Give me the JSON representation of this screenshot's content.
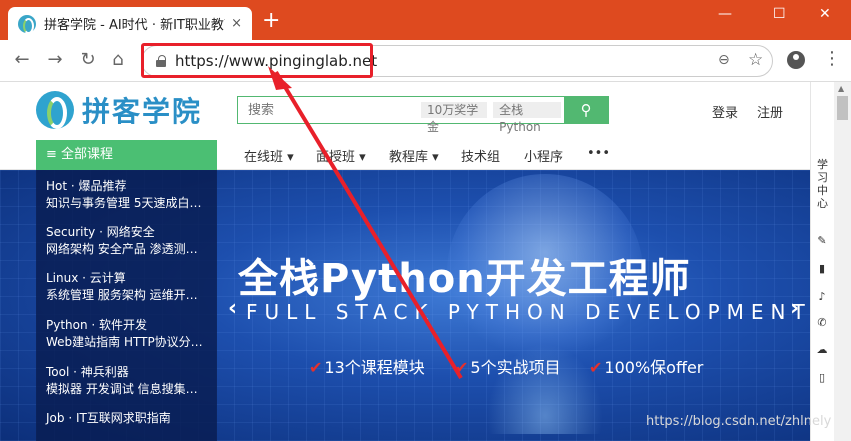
{
  "browser": {
    "tab_title": "拼客学院 - AI时代 · 新IT职业教育",
    "tab_close": "×",
    "new_tab": "+",
    "url": "https://www.pinginglab.net",
    "controls": {
      "minimize": "—",
      "maximize": "☐",
      "close": "✕"
    },
    "nav": {
      "back": "←",
      "forward": "→",
      "reload": "↻",
      "home": "⌂"
    },
    "icons": {
      "zoom": "⊖",
      "star": "☆",
      "menu": "⋮"
    }
  },
  "site": {
    "logo_text": "拼客学院",
    "search_placeholder": "搜索",
    "search_tags": [
      "10万奖学金",
      "全栈Python"
    ],
    "search_button": "⚲",
    "login": "登录",
    "register": "注册",
    "all_courses": "≡  全部课程",
    "nav_items": [
      "在线班 ▾",
      "面授班 ▾",
      "教程库 ▾",
      "技术组",
      "小程序",
      "•••"
    ]
  },
  "categories": [
    {
      "title": "Hot · 爆品推荐",
      "sub": "知识与事务管理  5天速成白…"
    },
    {
      "title": "Security · 网络安全",
      "sub": "网络架构  安全产品  渗透测…"
    },
    {
      "title": "Linux · 云计算",
      "sub": "系统管理  服务架构  运维开…"
    },
    {
      "title": "Python · 软件开发",
      "sub": "Web建站指南  HTTP协议分…"
    },
    {
      "title": "Tool · 神兵利器",
      "sub": "模拟器  开发调试  信息搜集…"
    },
    {
      "title": "Job · IT互联网求职指南",
      "sub": ""
    }
  ],
  "banner": {
    "headline": "全栈Python开发工程师",
    "subline": "FULL STACK PYTHON DEVELOPMENT",
    "prev": "‹",
    "next": "›",
    "features": [
      "13个课程模块",
      "5个实战项目",
      "100%保offer"
    ],
    "check": "✔"
  },
  "side": {
    "label": "学习中心",
    "icons": [
      "✎",
      "▮",
      "♪",
      "✆",
      "☁",
      "▯"
    ]
  },
  "watermark": "https://blog.csdn.net/zhlnely"
}
